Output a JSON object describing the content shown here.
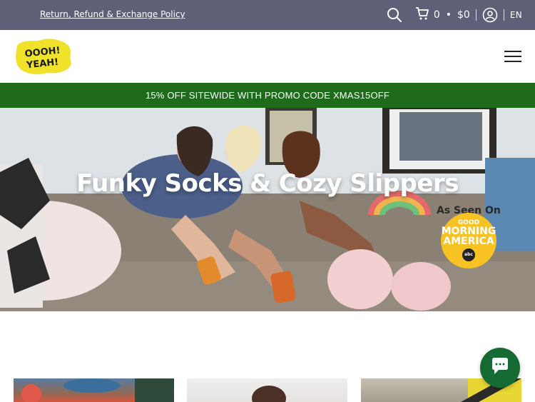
{
  "topbar": {
    "policy_link": "Return, Refund & Exchange Policy",
    "cart_count": "0",
    "cart_total": "$0",
    "language": "EN",
    "background": "#5d6077"
  },
  "header": {
    "logo_text": "OOOH! YEAH!",
    "logo_color": "#f0e12b"
  },
  "promo": {
    "text": "15% OFF SITEWIDE WITH PROMO CODE XMAS15OFF",
    "background": "#1d6b1b"
  },
  "hero": {
    "title": "Funky Socks & Cozy Slippers",
    "seen_on": "As Seen On",
    "gma_line1": "GOOD",
    "gma_line2": "MORNING",
    "gma_line3": "AMERICA",
    "gma_network": "abc"
  },
  "icons": {
    "search": "search-icon",
    "cart": "cart-icon",
    "account": "account-icon",
    "menu": "hamburger-icon",
    "chat": "chat-icon"
  },
  "chat": {
    "background": "#166b32"
  }
}
